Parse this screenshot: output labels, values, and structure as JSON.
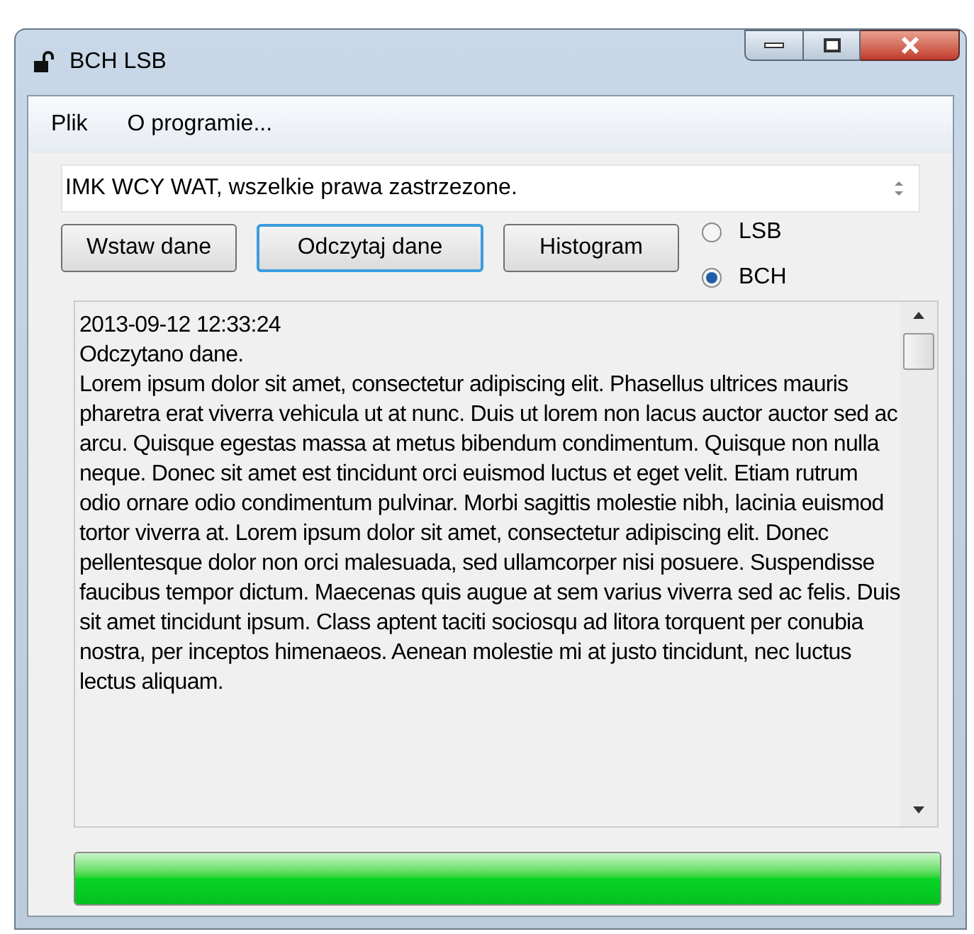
{
  "window": {
    "title": "BCH LSB"
  },
  "menu": [
    "Plik",
    "O programie..."
  ],
  "input": {
    "value": "IMK WCY WAT, wszelkie prawa zastrzezone."
  },
  "buttons": [
    {
      "label": "Wstaw dane",
      "focused": false
    },
    {
      "label": "Odczytaj dane",
      "focused": true
    },
    {
      "label": "Histogram",
      "focused": false
    }
  ],
  "modes": [
    {
      "label": "LSB",
      "selected": false
    },
    {
      "label": "BCH",
      "selected": true
    }
  ],
  "log": [
    "2013-09-12 12:33:24",
    "Odczytano dane.",
    "Lorem ipsum dolor sit amet, consectetur adipiscing elit. Phasellus ultrices mauris pharetra erat viverra vehicula ut at nunc. Duis ut lorem non lacus auctor auctor sed ac arcu. Quisque egestas massa at metus bibendum condimentum. Quisque non nulla neque. Donec sit amet est tincidunt orci euismod luctus et eget velit. Etiam rutrum odio ornare odio condimentum pulvinar. Morbi sagittis molestie nibh, lacinia euismod tortor viverra at. Lorem ipsum dolor sit amet, consectetur adipiscing elit. Donec pellentesque dolor non orci malesuada, sed ullamcorper nisi posuere. Suspendisse faucibus tempor dictum. Maecenas quis augue at sem varius viverra sed ac felis. Duis sit amet tincidunt ipsum. Class aptent taciti sociosqu ad litora torquent per conubia nostra, per inceptos himenaeos. Aenean molestie mi at justo tincidunt, nec luctus lectus aliquam."
  ],
  "progress": {
    "level": 1
  }
}
